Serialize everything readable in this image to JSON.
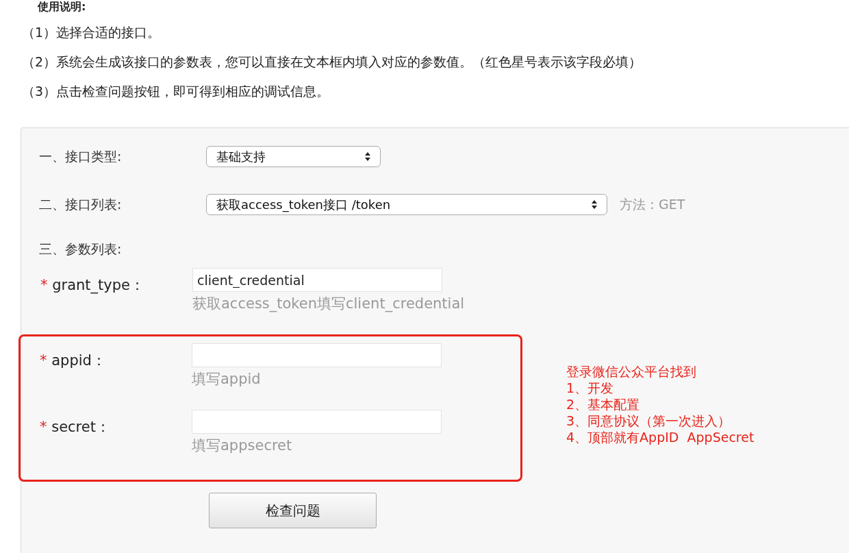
{
  "heading": "使用说明:",
  "instructions": [
    "（1）选择合适的接口。",
    "（2）系统会生成该接口的参数表，您可以直接在文本框内填入对应的参数值。（红色星号表示该字段必填）",
    "（3）点击检查问题按钮，即可得到相应的调试信息。"
  ],
  "form": {
    "interface_type": {
      "label": "一、接口类型:",
      "value": "基础支持"
    },
    "interface_list": {
      "label": "二、接口列表:",
      "value": "获取access_token接口 /token",
      "method": "方法：GET"
    },
    "params_label": "三、参数列表:",
    "required_mark": "*",
    "params": [
      {
        "name": "grant_type：",
        "required": true,
        "value": "client_credential",
        "hint": "获取access_token填写client_credential"
      }
    ],
    "annotated": {
      "params": [
        {
          "name": "appid：",
          "required": true,
          "hint": "填写appid"
        },
        {
          "name": "secret：",
          "required": true,
          "hint": "填写appsecret"
        }
      ],
      "note": [
        "登录微信公众平台找到",
        "1、开发",
        "2、基本配置",
        "3、同意协议（第一次进入）",
        "4、顶部就有AppID  AppSecret"
      ]
    },
    "submit": "检查问题"
  }
}
